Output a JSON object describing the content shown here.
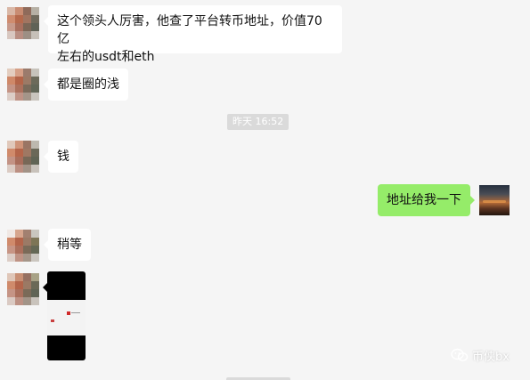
{
  "colors": {
    "background": "#f5f5f5",
    "incoming_bubble": "#ffffff",
    "outgoing_bubble": "#95ec69",
    "timestamp_bg": "#dadada"
  },
  "messages": [
    {
      "side": "left",
      "text_line1": "这个领头人厉害，他查了平台转币地址，价值70亿",
      "text_line2": "左右的usdt和eth"
    },
    {
      "side": "left",
      "text": "都是圈的浅"
    },
    {
      "timestamp": "昨天 16:52"
    },
    {
      "side": "left",
      "text": "钱"
    },
    {
      "side": "right",
      "text": "地址给我一下"
    },
    {
      "side": "left",
      "text": "稍等"
    },
    {
      "side": "left",
      "type": "image"
    }
  ],
  "watermark": {
    "icon": "wechat-official-account-icon",
    "text": "币侠bx"
  }
}
